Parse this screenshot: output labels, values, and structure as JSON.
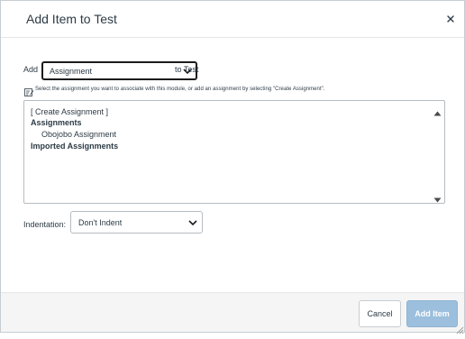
{
  "dialog": {
    "title": "Add Item to Test"
  },
  "add_row": {
    "prefix": "Add",
    "selected_type": "Assignment",
    "suffix": "to Test"
  },
  "hint": {
    "text": "Select the assignment you want to associate with this module, or add an assignment by selecting \"Create Assignment\"."
  },
  "listbox": {
    "create_option": "[ Create Assignment ]",
    "groups": [
      {
        "label": "Assignments",
        "items": [
          "Obojobo Assignment"
        ]
      },
      {
        "label": "Imported Assignments",
        "items": []
      }
    ]
  },
  "indentation": {
    "label": "Indentation:",
    "selected": "Don't Indent"
  },
  "footer": {
    "cancel_label": "Cancel",
    "add_label": "Add Item"
  },
  "colors": {
    "add_button": "#9bbfdc",
    "text": "#2d3b45",
    "footer_bg": "#f5f5f5"
  },
  "icons": {
    "close": "close-icon",
    "select_chevron": "chevron-down-icon",
    "hint": "edit-note-icon",
    "scroll_up": "scroll-up-arrow",
    "scroll_down": "scroll-down-arrow",
    "resize": "resize-grip-icon"
  }
}
